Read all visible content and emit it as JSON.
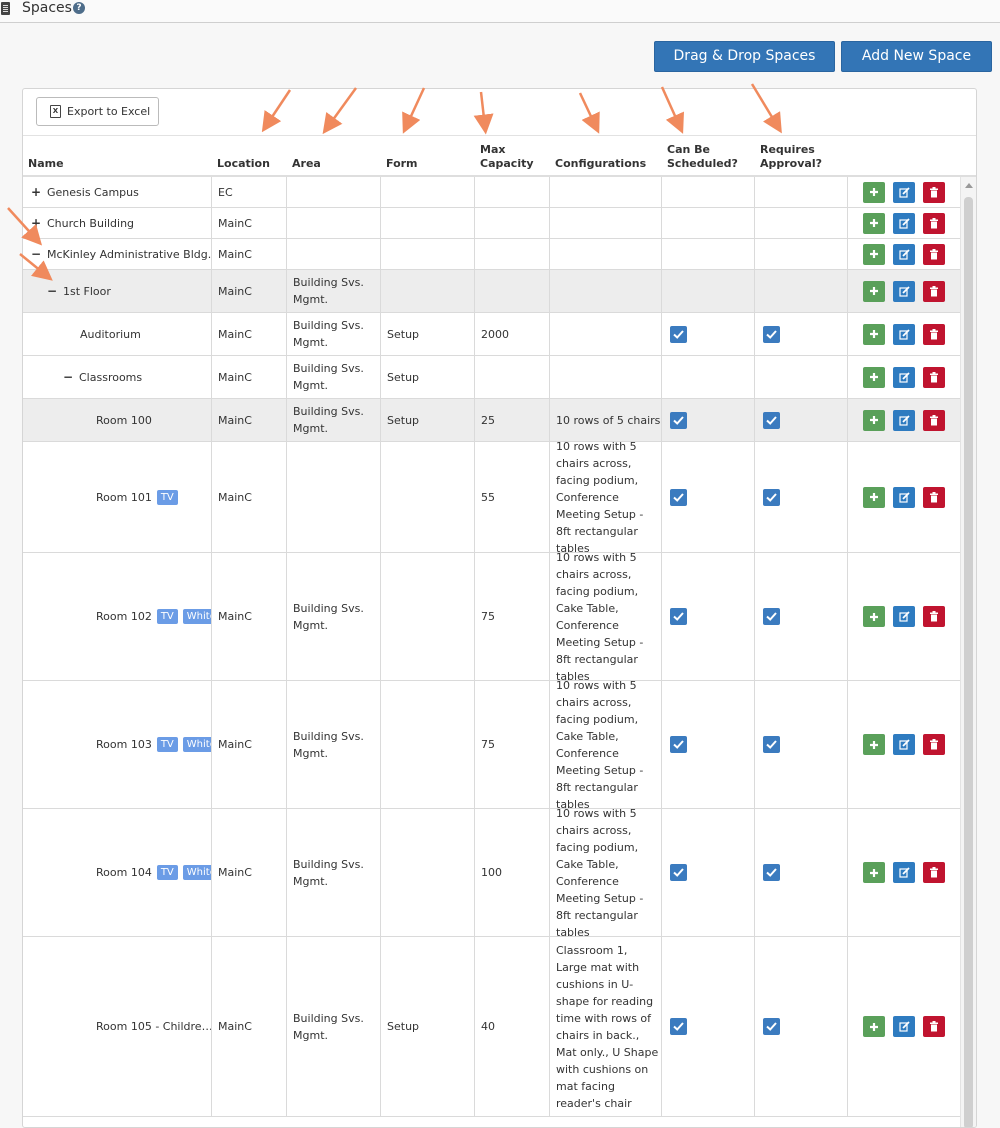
{
  "header": {
    "title": "Spaces",
    "help_glyph": "?"
  },
  "toolbar": {
    "drag_drop_label": "Drag & Drop Spaces",
    "add_new_label": "Add New Space",
    "export_label": "Export to Excel"
  },
  "columns": {
    "name": "Name",
    "location": "Location",
    "area": "Area",
    "form": "Form",
    "max_capacity_1": "Max",
    "max_capacity_2": "Capacity",
    "configurations": "Configurations",
    "can_be_scheduled_1": "Can Be",
    "can_be_scheduled_2": "Scheduled?",
    "requires_approval_1": "Requires",
    "requires_approval_2": "Approval?"
  },
  "rows": [
    {
      "toggle": "+",
      "name": "Genesis Campus",
      "location": "EC",
      "area": "",
      "form": "",
      "max": "",
      "config": "",
      "scheduled": false,
      "approval": false,
      "tags": []
    },
    {
      "toggle": "+",
      "name": "Church Building",
      "location": "MainC",
      "area": "",
      "form": "",
      "max": "",
      "config": "",
      "scheduled": false,
      "approval": false,
      "tags": []
    },
    {
      "toggle": "−",
      "name": "McKinley Administrative Bldg.",
      "location": "MainC",
      "area": "",
      "form": "",
      "max": "",
      "config": "",
      "scheduled": false,
      "approval": false,
      "tags": []
    },
    {
      "toggle": "−",
      "name": "1st Floor",
      "location": "MainC",
      "area": "Building Svs. Mgmt.",
      "form": "",
      "max": "",
      "config": "",
      "scheduled": false,
      "approval": false,
      "tags": []
    },
    {
      "toggle": "",
      "name": "Auditorium",
      "location": "MainC",
      "area": "Building Svs. Mgmt.",
      "form": "Setup",
      "max": "2000",
      "config": "",
      "scheduled": true,
      "approval": true,
      "tags": []
    },
    {
      "toggle": "−",
      "name": "Classrooms",
      "location": "MainC",
      "area": "Building Svs. Mgmt.",
      "form": "Setup",
      "max": "",
      "config": "",
      "scheduled": false,
      "approval": false,
      "tags": []
    },
    {
      "toggle": "",
      "name": "Room 100",
      "location": "MainC",
      "area": "Building Svs. Mgmt.",
      "form": "Setup",
      "max": "25",
      "config": "10 rows of 5 chairs",
      "scheduled": true,
      "approval": true,
      "tags": []
    },
    {
      "toggle": "",
      "name": "Room 101",
      "location": "MainC",
      "area": "",
      "form": "",
      "max": "55",
      "config": "10 rows with 5 chairs across, facing podium, Conference Meeting Setup - 8ft rectangular tables",
      "scheduled": true,
      "approval": true,
      "tags": [
        "TV"
      ]
    },
    {
      "toggle": "",
      "name": "Room 102",
      "location": "MainC",
      "area": "Building Svs. Mgmt.",
      "form": "",
      "max": "75",
      "config": "10 rows with 5 chairs across, facing podium, Cake Table, Conference Meeting Setup - 8ft rectangular tables",
      "scheduled": true,
      "approval": true,
      "tags": [
        "TV",
        "Whiteboard"
      ]
    },
    {
      "toggle": "",
      "name": "Room 103",
      "location": "MainC",
      "area": "Building Svs. Mgmt.",
      "form": "",
      "max": "75",
      "config": "10 rows with 5 chairs across, facing podium, Cake Table, Conference Meeting Setup - 8ft rectangular tables",
      "scheduled": true,
      "approval": true,
      "tags": [
        "TV",
        "Whiteboard"
      ]
    },
    {
      "toggle": "",
      "name": "Room 104",
      "location": "MainC",
      "area": "Building Svs. Mgmt.",
      "form": "",
      "max": "100",
      "config": "10 rows with 5 chairs across, facing podium, Cake Table, Conference Meeting Setup - 8ft rectangular tables",
      "scheduled": true,
      "approval": true,
      "tags": [
        "TV",
        "Whiteboard"
      ]
    },
    {
      "toggle": "",
      "name": "Room 105 - Childre…",
      "location": "MainC",
      "area": "Building Svs. Mgmt.",
      "form": "Setup",
      "max": "40",
      "config": "Classroom 1, Large mat with cushions in U-shape for reading time with rows of chairs in back., Mat only., U Shape with cushions on mat facing reader's chair",
      "scheduled": true,
      "approval": true,
      "tags": []
    }
  ]
}
